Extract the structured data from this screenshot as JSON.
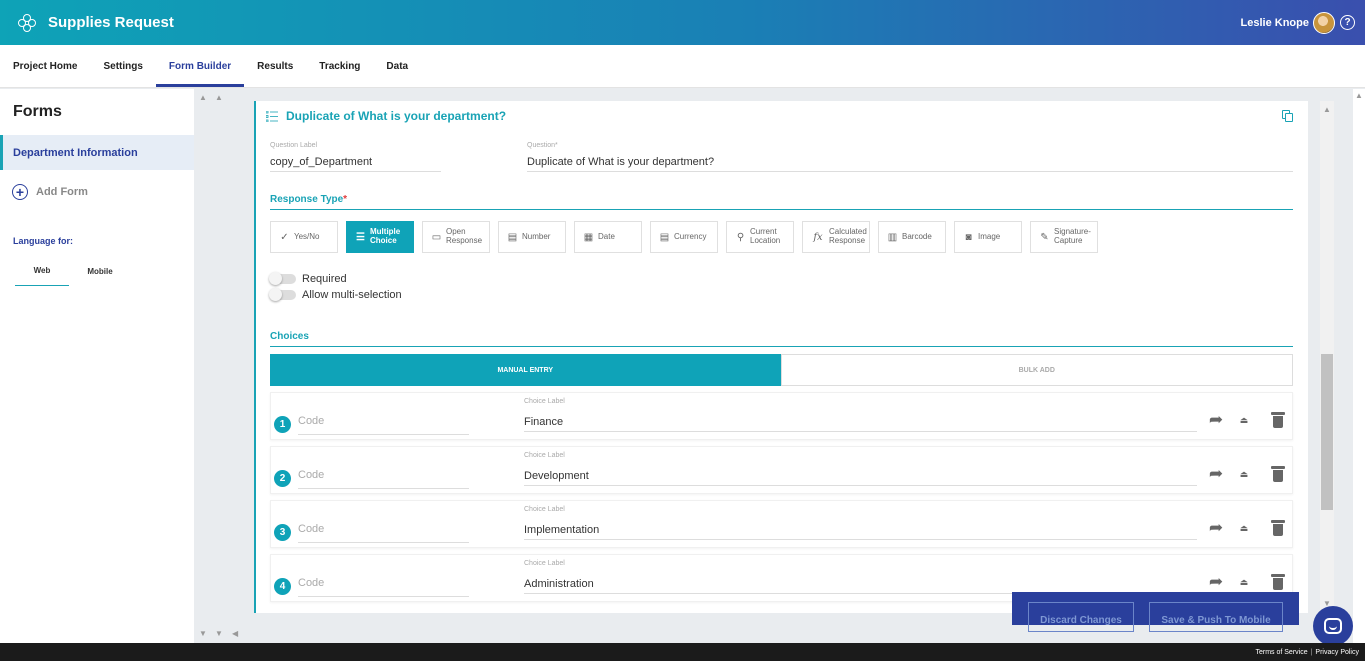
{
  "header": {
    "app_title": "Supplies Request",
    "user_name": "Leslie Knope",
    "help_glyph": "?"
  },
  "nav": {
    "tabs": [
      {
        "label": "Project Home"
      },
      {
        "label": "Settings"
      },
      {
        "label": "Form Builder",
        "active": true
      },
      {
        "label": "Results"
      },
      {
        "label": "Tracking"
      },
      {
        "label": "Data"
      }
    ]
  },
  "sidebar": {
    "title": "Forms",
    "items": [
      {
        "label": "Department Information",
        "active": true
      }
    ],
    "add_form": "Add Form",
    "language_label": "Language for:",
    "language_tabs": [
      {
        "label": "Web",
        "active": true
      },
      {
        "label": "Mobile"
      }
    ]
  },
  "question": {
    "title": "Duplicate of What is your department?",
    "label_caption": "Question Label",
    "label_value": "copy_of_Department",
    "question_caption": "Question*",
    "question_value": "Duplicate of What is your department?"
  },
  "response_type": {
    "title": "Response Type",
    "required_star": "*",
    "types": [
      {
        "line1": "Yes/No",
        "line2": "",
        "icon": "yes-no-icon",
        "glyph": "✓"
      },
      {
        "line1": "Multiple",
        "line2": "Choice",
        "icon": "list-icon",
        "glyph": "☰",
        "active": true
      },
      {
        "line1": "Open",
        "line2": "Response",
        "icon": "text-box-icon",
        "glyph": "▭"
      },
      {
        "line1": "Number",
        "line2": "",
        "icon": "number-icon",
        "glyph": "▤"
      },
      {
        "line1": "Date",
        "line2": "",
        "icon": "calendar-icon",
        "glyph": "▦"
      },
      {
        "line1": "Currency",
        "line2": "",
        "icon": "currency-icon",
        "glyph": "▤"
      },
      {
        "line1": "Current",
        "line2": "Location",
        "icon": "location-pin-icon",
        "glyph": "⚲"
      },
      {
        "line1": "Calculated",
        "line2": "Response",
        "icon": "function-icon",
        "glyph": "fx"
      },
      {
        "line1": "Barcode",
        "line2": "",
        "icon": "barcode-icon",
        "glyph": "▥"
      },
      {
        "line1": "Image",
        "line2": "",
        "icon": "camera-icon",
        "glyph": "◙"
      },
      {
        "line1": "Signature-",
        "line2": "Capture",
        "icon": "pen-icon",
        "glyph": "✎"
      }
    ]
  },
  "options": {
    "required": "Required",
    "multi": "Allow multi-selection"
  },
  "choices": {
    "title": "Choices",
    "tab_manual": "MANUAL ENTRY",
    "tab_bulk": "BULK ADD",
    "code_placeholder": "Code",
    "label_caption": "Choice Label",
    "rows": [
      {
        "num": "1",
        "label": "Finance"
      },
      {
        "num": "2",
        "label": "Development"
      },
      {
        "num": "3",
        "label": "Implementation"
      },
      {
        "num": "4",
        "label": "Administration"
      }
    ]
  },
  "actions": {
    "discard": "Discard Changes",
    "push": "Save & Push To Mobile"
  },
  "footer": {
    "terms": "Terms of Service",
    "separator": "|",
    "privacy": "Privacy Policy"
  },
  "colors": {
    "accent": "#0fa3b8",
    "brand": "#2a3f9c"
  }
}
